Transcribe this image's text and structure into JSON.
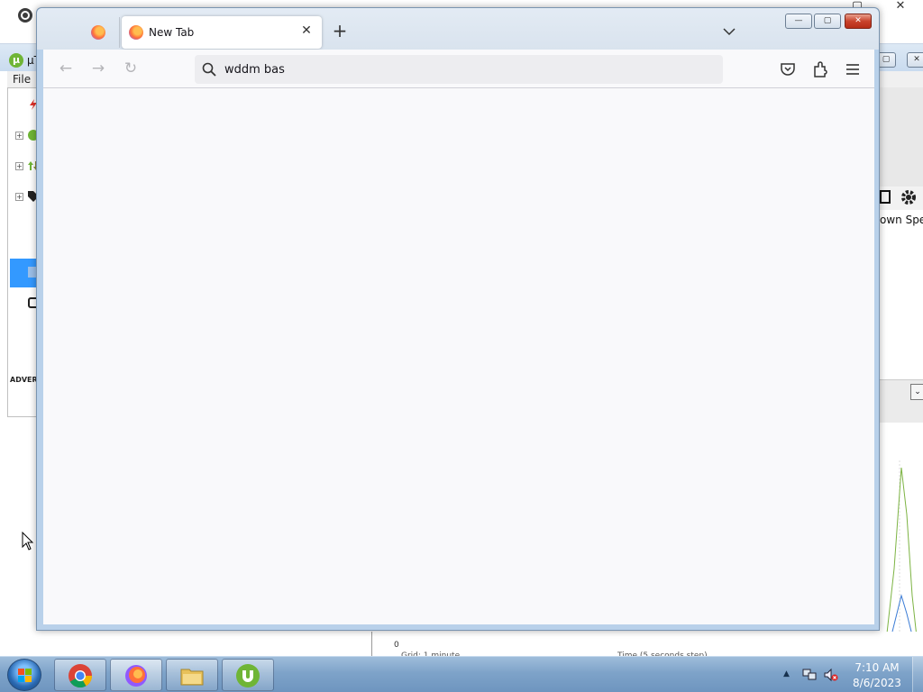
{
  "desktop": {
    "chrome_window": {
      "icon": "chrome-icon",
      "close_glyph": "✕"
    },
    "utorrent_window": {
      "title": "µT",
      "menu_file": "File",
      "advert_label": "ADVERTI",
      "column_header": "own Speed",
      "graph_zero": "0",
      "graph_grid_label": "Grid: 1 minute",
      "graph_time_label": "Time (5 seconds step)",
      "sidebar_icons": [
        "lightning-icon",
        "rss-feed-icon",
        "arrows-icon",
        "label-icon",
        "rss-icon",
        "device-icon"
      ]
    }
  },
  "firefox": {
    "tabs": [
      {
        "title": "",
        "icon": "firefox-icon",
        "active": false
      },
      {
        "title": "New Tab",
        "icon": "firefox-icon",
        "active": true
      }
    ],
    "tab_close_glyph": "✕",
    "new_tab_glyph": "+",
    "caption": {
      "minimize": "—",
      "maximize": "▢",
      "close": "✕"
    },
    "toolbar": {
      "back_glyph": "←",
      "forward_glyph": "→",
      "reload_glyph": "↻",
      "url_value": "wddm bas"
    }
  },
  "taskbar": {
    "items": [
      {
        "name": "chrome",
        "icon": "chrome-icon"
      },
      {
        "name": "firefox",
        "icon": "firefox-icon"
      },
      {
        "name": "file-explorer",
        "icon": "folder-icon"
      },
      {
        "name": "utorrent",
        "icon": "utorrent-icon"
      }
    ],
    "tray_chevron": "▲",
    "time": "7:10 AM",
    "date": "8/6/2023"
  },
  "colors": {
    "taskbar": "#7ea3c9",
    "firefox_content": "#f9f9fb",
    "utorrent_selection": "#3399ff",
    "close_button": "#c9432c"
  }
}
